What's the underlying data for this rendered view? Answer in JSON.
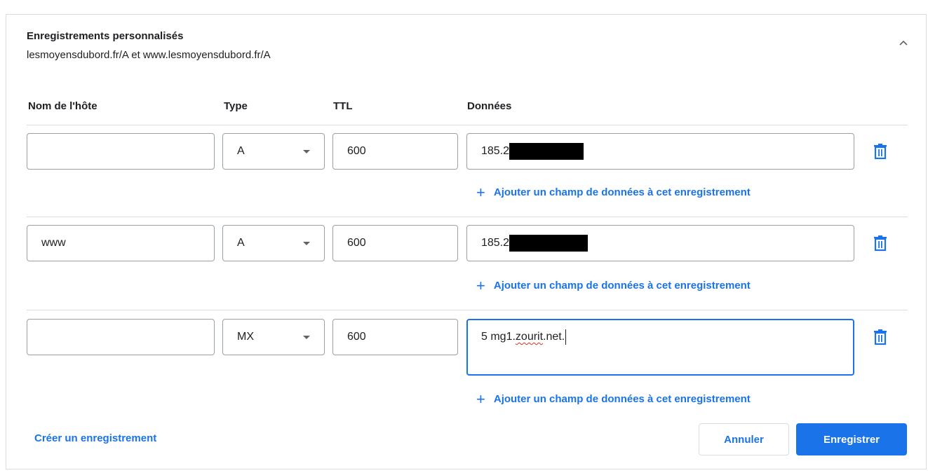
{
  "section": {
    "title": "Enregistrements personnalisés",
    "subtitle": "lesmoyensdubord.fr/A et www.lesmoyensdubord.fr/A"
  },
  "columns": {
    "host": "Nom de l'hôte",
    "type": "Type",
    "ttl": "TTL",
    "data": "Données"
  },
  "records": [
    {
      "host": "",
      "type": "A",
      "ttl": "600",
      "data": "185.2",
      "redacted": true
    },
    {
      "host": "www",
      "type": "A",
      "ttl": "600",
      "data": "185.2",
      "redacted": true
    },
    {
      "host": "",
      "type": "MX",
      "ttl": "600",
      "data_prefix": "5 mg1.",
      "data_misspelled": "zourit",
      "data_suffix": ".net.",
      "redacted": false
    }
  ],
  "add_data_field_label": "Ajouter un champ de données à cet enregistrement",
  "create_record_label": "Créer un enregistrement",
  "buttons": {
    "cancel": "Annuler",
    "save": "Enregistrer"
  },
  "colors": {
    "accent": "#1a73e8",
    "border": "#9aa0a6",
    "divider": "#dadce0"
  },
  "icons": {
    "collapse": "chevron-up-icon",
    "delete": "trash-icon",
    "dropdown": "caret-down-icon",
    "add": "plus-icon"
  }
}
